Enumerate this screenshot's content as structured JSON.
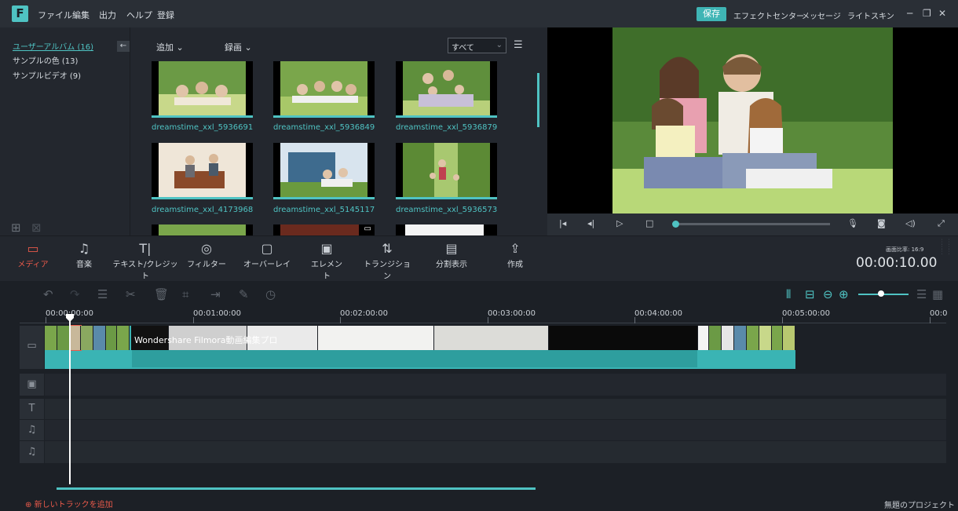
{
  "menu": [
    "ファイル",
    "編集",
    "出力",
    "ヘルプ",
    "登録"
  ],
  "top_right": {
    "save": "保存",
    "items": [
      "エフェクトセンター",
      "メッセージ",
      "ライトスキン"
    ]
  },
  "albums": [
    {
      "label": "ユーザーアルバム (16)",
      "active": true
    },
    {
      "label": "サンプルの色 (13)",
      "active": false
    },
    {
      "label": "サンプルビデオ (9)",
      "active": false
    }
  ],
  "library_toolbar": {
    "add": "追加",
    "record": "録画",
    "filter": "すべて"
  },
  "media": [
    {
      "name": "dreamstime_xxl_5936691",
      "palette": [
        "#6b9a45",
        "#d9c8a0",
        "#3c5e2a"
      ]
    },
    {
      "name": "dreamstime_xxl_5936849",
      "palette": [
        "#7aa64b",
        "#e0d0b0",
        "#4a6e2e"
      ]
    },
    {
      "name": "dreamstime_xxl_5936879",
      "palette": [
        "#5f8f3c",
        "#c9b89a",
        "#3a5a26"
      ]
    },
    {
      "name": "dreamstime_xxl_4173968",
      "palette": [
        "#efe6d8",
        "#8a4a2a",
        "#d0c3b0"
      ]
    },
    {
      "name": "dreamstime_xxl_5145117",
      "palette": [
        "#4a6fa0",
        "#3e6b8e",
        "#6a9a3e"
      ]
    },
    {
      "name": "dreamstime_xxl_5936573",
      "palette": [
        "#5c8a35",
        "#a8c870",
        "#3c6028"
      ]
    }
  ],
  "toolbar": [
    {
      "label": "メディア",
      "icon": "folder-icon",
      "active": true
    },
    {
      "label": "音楽",
      "icon": "music-icon",
      "active": false
    },
    {
      "label": "テキスト/クレジット",
      "icon": "text-icon",
      "active": false
    },
    {
      "label": "フィルター",
      "icon": "filter-icon",
      "active": false
    },
    {
      "label": "オーバーレイ",
      "icon": "overlay-icon",
      "active": false
    },
    {
      "label": "エレメント",
      "icon": "element-icon",
      "active": false
    },
    {
      "label": "トランジション",
      "icon": "transition-icon",
      "active": false
    },
    {
      "label": "分割表示",
      "icon": "split-icon",
      "active": false
    },
    {
      "label": "作成",
      "icon": "export-icon",
      "active": false
    }
  ],
  "preview": {
    "ratio": "画面比率: 16:9",
    "timecode": "00:00:10.00"
  },
  "ruler": [
    "00:00:00:00",
    "00:01:00:00",
    "00:02:00:00",
    "00:03:00:00",
    "00:04:00:00",
    "00:05:00:00",
    "00:0"
  ],
  "timeline": {
    "title_clip": "Wondershare Filmora動画編集プロ",
    "add_track": "新しいトラックを追加",
    "project": "無題のプロジェクト"
  }
}
